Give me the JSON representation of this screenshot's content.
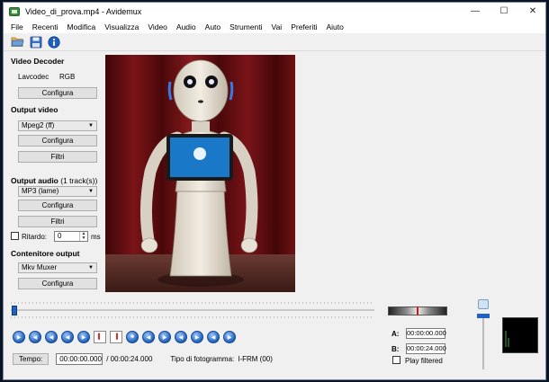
{
  "window": {
    "title": "Video_di_prova.mp4 - Avidemux",
    "minimize": "—",
    "maximize": "☐",
    "close": "✕"
  },
  "menu": [
    "File",
    "Recenti",
    "Modifica",
    "Visualizza",
    "Video",
    "Audio",
    "Auto",
    "Strumenti",
    "Vai",
    "Preferiti",
    "Aiuto"
  ],
  "toolbar": {
    "icons": [
      "open-folder-icon",
      "save-disk-icon",
      "info-icon"
    ]
  },
  "video_decoder": {
    "title": "Video Decoder",
    "decoder_name": "Lavcodec",
    "decoder_format": "RGB",
    "configure_label": "Configura"
  },
  "output_video": {
    "title": "Output video",
    "codec": "Mpeg2 (ff)",
    "configure_label": "Configura",
    "filters_label": "Filtri"
  },
  "output_audio": {
    "title": "Output audio",
    "tracks": "(1 track(s))",
    "codec": "MP3 (lame)",
    "configure_label": "Configura",
    "filters_label": "Filtri",
    "delay_label": "Ritardo:",
    "delay_value": "0",
    "delay_unit": "ms"
  },
  "output_container": {
    "title": "Contenitore output",
    "format": "Mkv Muxer",
    "configure_label": "Configura"
  },
  "playback": {
    "time_button": "Tempo:",
    "current_time": "00:00:00.000",
    "total_time": "/ 00:00:24.000",
    "frame_type_label": "Tipo di fotogramma:",
    "frame_type_value": "I-FRM (00)",
    "position_fraction": 0.0
  },
  "markers": {
    "a_label": "A:",
    "a_value": "00:00:00.000",
    "b_label": "B:",
    "b_value": "00:00:24.000",
    "play_filtered_label": "Play filtered"
  },
  "controls": [
    "play",
    "rewind",
    "back",
    "back-one",
    "forward-one",
    "set-marker-a",
    "set-marker-b",
    "prev-black",
    "prev-keyframe",
    "next-keyframe",
    "go-start",
    "go-end",
    "prev-segment",
    "next-segment"
  ],
  "colors": {
    "accent": "#1e63c4",
    "video_background": "#5a0e10"
  }
}
